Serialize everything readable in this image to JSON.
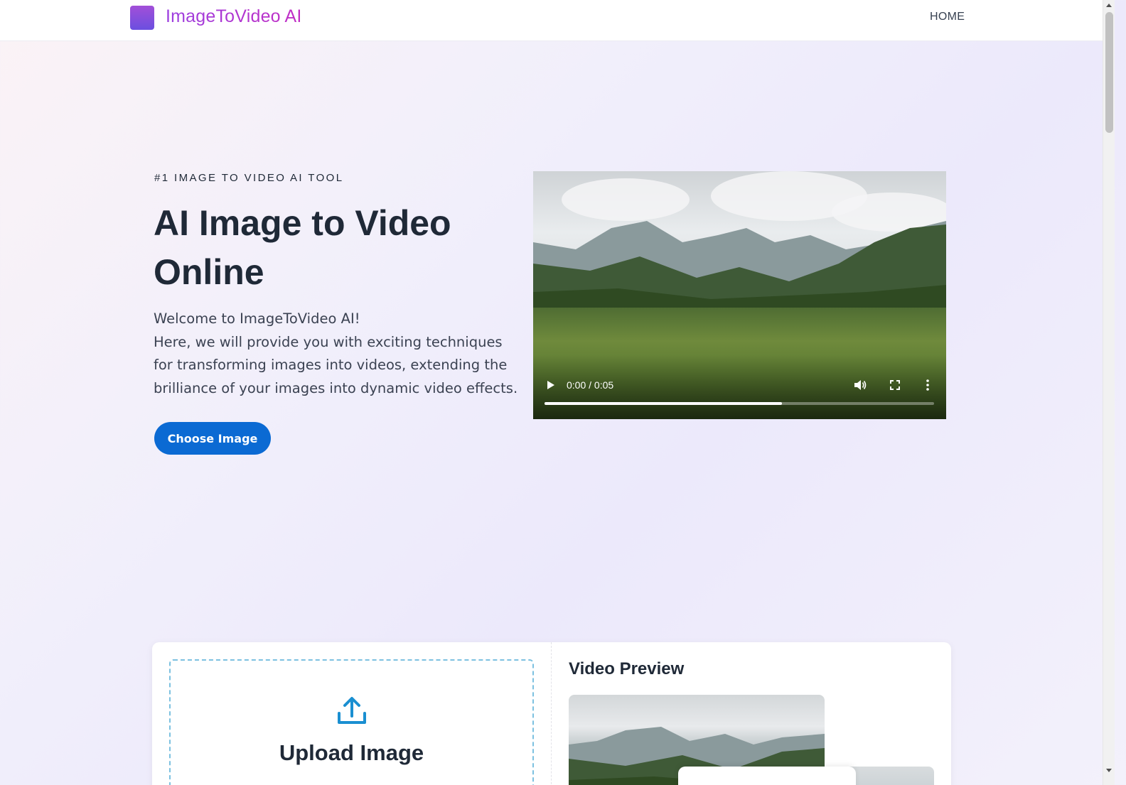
{
  "header": {
    "brand": "ImageToVideo AI",
    "nav": {
      "home": "HOME"
    }
  },
  "hero": {
    "eyebrow": "#1 IMAGE TO VIDEO AI TOOL",
    "title": "AI Image to Video Online",
    "description_lines": [
      "Welcome to ImageToVideo AI!",
      "Here, we will provide you with exciting techniques for transforming images into videos, extending the brilliance of your images into dynamic video effects."
    ],
    "cta": "Choose Image"
  },
  "video_player": {
    "time": "0:00 / 0:05",
    "progress_fraction": 0.61,
    "icons": [
      "play-icon",
      "volume-icon",
      "fullscreen-icon",
      "more-options-icon"
    ]
  },
  "upload": {
    "title": "Upload Image",
    "icon": "upload-icon"
  },
  "preview": {
    "title": "Video Preview"
  },
  "colors": {
    "brand_gradient_start": "#9c3fe0",
    "brand_gradient_end": "#c22ec4",
    "cta_blue": "#0b6ad3",
    "upload_border": "#7cc1e0",
    "upload_icon": "#1a8fd1",
    "text_dark": "#1f2937"
  }
}
